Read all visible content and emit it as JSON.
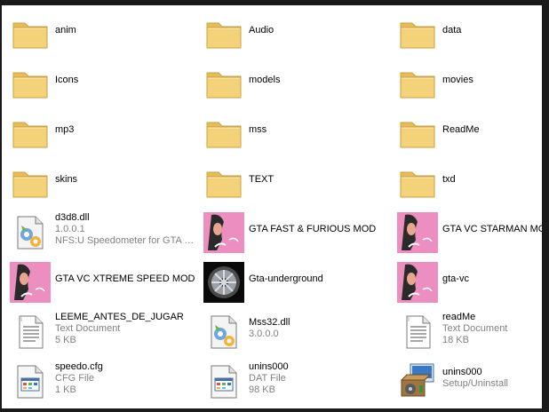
{
  "colors": {
    "folder_body": "#F4D27A",
    "folder_tab": "#E8BD55",
    "pink": "#E97DB5",
    "text": "#000000",
    "subtext": "#808080"
  },
  "items": [
    {
      "name": "anim",
      "icon": "folder-icon",
      "details": []
    },
    {
      "name": "Audio",
      "icon": "folder-icon",
      "details": []
    },
    {
      "name": "data",
      "icon": "folder-icon",
      "details": []
    },
    {
      "name": "Icons",
      "icon": "folder-icon",
      "details": []
    },
    {
      "name": "models",
      "icon": "folder-icon",
      "details": []
    },
    {
      "name": "movies",
      "icon": "folder-icon",
      "details": []
    },
    {
      "name": "mp3",
      "icon": "folder-icon",
      "details": []
    },
    {
      "name": "mss",
      "icon": "folder-icon",
      "details": []
    },
    {
      "name": "ReadMe",
      "icon": "folder-icon",
      "details": []
    },
    {
      "name": "skins",
      "icon": "folder-icon",
      "details": []
    },
    {
      "name": "TEXT",
      "icon": "folder-icon",
      "details": []
    },
    {
      "name": "txd",
      "icon": "folder-icon",
      "details": []
    },
    {
      "name": "d3d8.dll",
      "icon": "dll-icon",
      "details": [
        "1.0.0.1",
        "NFS:U Speedometer for GTA V..."
      ]
    },
    {
      "name": "GTA FAST & FURIOUS MOD",
      "icon": "vc-app-icon",
      "details": []
    },
    {
      "name": "GTA VC STARMAN MOD",
      "icon": "vc-app-icon",
      "details": []
    },
    {
      "name": "GTA VC XTREME SPEED MOD",
      "icon": "vc-app-icon",
      "details": []
    },
    {
      "name": "Gta-underground",
      "icon": "wheel-app-icon",
      "details": []
    },
    {
      "name": "gta-vc",
      "icon": "vc-app-icon",
      "details": []
    },
    {
      "name": "LEEME_ANTES_DE_JUGAR",
      "icon": "text-document-icon",
      "details": [
        "Text Document",
        "5 KB"
      ]
    },
    {
      "name": "Mss32.dll",
      "icon": "dll-icon",
      "details": [
        "3.0.0.0"
      ]
    },
    {
      "name": "readMe",
      "icon": "text-document-icon",
      "details": [
        "Text Document",
        "18 KB"
      ]
    },
    {
      "name": "speedo.cfg",
      "icon": "cfg-file-icon",
      "details": [
        "CFG File",
        "1 KB"
      ]
    },
    {
      "name": "unins000",
      "icon": "dat-file-icon",
      "details": [
        "DAT File",
        "98 KB"
      ]
    },
    {
      "name": "unins000",
      "icon": "setup-icon",
      "details": [
        "Setup/Uninstall"
      ]
    }
  ]
}
